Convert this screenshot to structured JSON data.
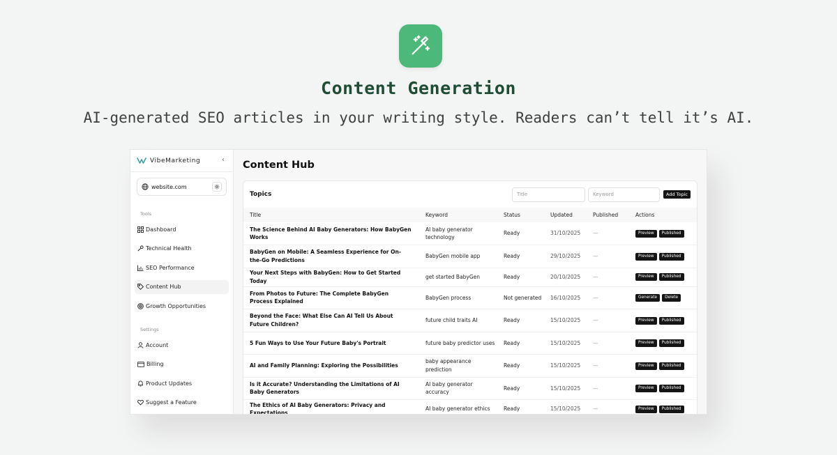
{
  "hero": {
    "title": "Content Generation",
    "subtitle": "AI-generated SEO articles in your writing style. Readers can’t tell it’s AI.",
    "icon": "magic-wand-icon",
    "accent": "#4cb97a"
  },
  "sidebar": {
    "brand": "VibeMarketing",
    "site": "website.com",
    "tools_label": "Tools",
    "tools": [
      {
        "label": "Dashboard",
        "icon": "grid-icon"
      },
      {
        "label": "Technical Health",
        "icon": "wrench-icon"
      },
      {
        "label": "SEO Performance",
        "icon": "bar-chart-icon"
      },
      {
        "label": "Content Hub",
        "icon": "tag-icon",
        "active": true
      },
      {
        "label": "Growth Opportunities",
        "icon": "target-icon"
      }
    ],
    "settings_label": "Settings",
    "settings": [
      {
        "label": "Account",
        "icon": "user-icon"
      },
      {
        "label": "Billing",
        "icon": "card-icon"
      },
      {
        "label": "Product Updates",
        "icon": "bell-icon"
      },
      {
        "label": "Suggest a Feature",
        "icon": "heart-icon"
      }
    ]
  },
  "main": {
    "title": "Content Hub",
    "topics_label": "Topics",
    "title_placeholder": "Title",
    "keyword_placeholder": "Keyword",
    "add_label": "Add Topic",
    "columns": [
      "Title",
      "Keyword",
      "Status",
      "Updated",
      "Published",
      "Actions"
    ],
    "rows": [
      {
        "title": "The Science Behind AI Baby Generators: How BabyGen Works",
        "keyword": "AI baby generator technology",
        "status": "Ready",
        "updated": "31/10/2025",
        "published": "—",
        "actions": [
          "Preview",
          "Published"
        ]
      },
      {
        "title": "BabyGen on Mobile: A Seamless Experience for On-the-Go Predictions",
        "keyword": "BabyGen mobile app",
        "status": "Ready",
        "updated": "29/10/2025",
        "published": "—",
        "actions": [
          "Preview",
          "Published"
        ]
      },
      {
        "title": "Your Next Steps with BabyGen: How to Get Started Today",
        "keyword": "get started BabyGen",
        "status": "Ready",
        "updated": "20/10/2025",
        "published": "—",
        "actions": [
          "Preview",
          "Published"
        ]
      },
      {
        "title": "From Photos to Future: The Complete BabyGen Process Explained",
        "keyword": "BabyGen process",
        "status": "Not generated",
        "updated": "16/10/2025",
        "published": "—",
        "actions": [
          "Generate",
          "Delete"
        ]
      },
      {
        "title": "Beyond the Face: What Else Can AI Tell Us About Future Children?",
        "keyword": "future child traits AI",
        "status": "Ready",
        "updated": "15/10/2025",
        "published": "—",
        "actions": [
          "Preview",
          "Published"
        ]
      },
      {
        "title": "5 Fun Ways to Use Your Future Baby's Portrait",
        "keyword": "future baby predictor uses",
        "status": "Ready",
        "updated": "15/10/2025",
        "published": "—",
        "actions": [
          "Preview",
          "Published"
        ]
      },
      {
        "title": "AI and Family Planning: Exploring the Possibilities",
        "keyword": "baby appearance prediction",
        "status": "Ready",
        "updated": "15/10/2025",
        "published": "—",
        "actions": [
          "Preview",
          "Published"
        ]
      },
      {
        "title": "Is it Accurate? Understanding the Limitations of AI Baby Generators",
        "keyword": "AI baby generator accuracy",
        "status": "Ready",
        "updated": "15/10/2025",
        "published": "—",
        "actions": [
          "Preview",
          "Published"
        ]
      },
      {
        "title": "The Ethics of AI Baby Generators: Privacy and Expectations",
        "keyword": "AI baby generator ethics",
        "status": "Ready",
        "updated": "15/10/2025",
        "published": "—",
        "actions": [
          "Preview",
          "Published"
        ]
      }
    ]
  }
}
